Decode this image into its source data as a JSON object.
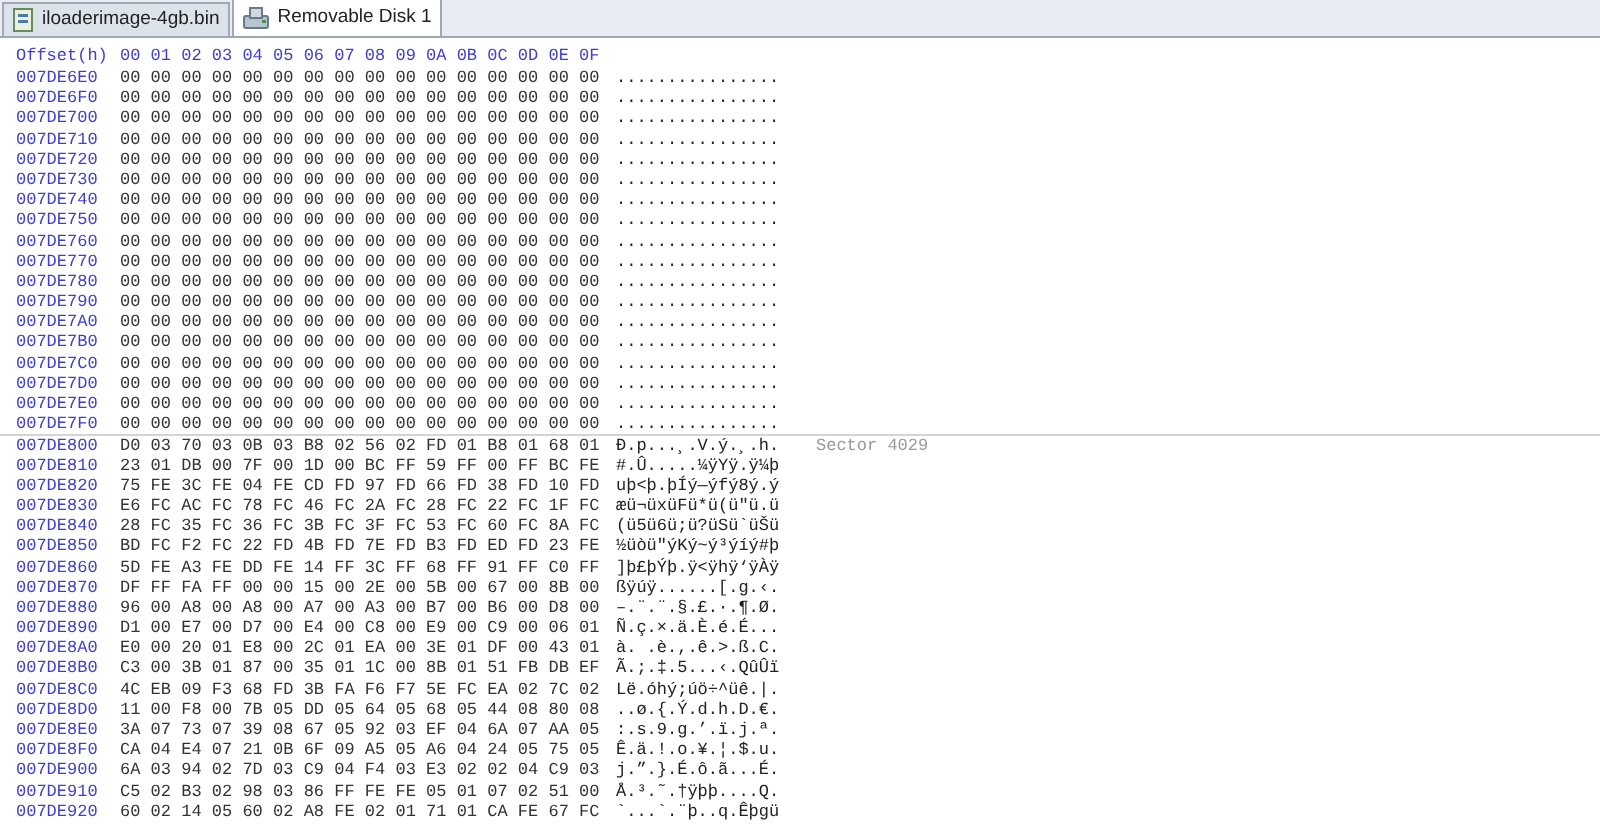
{
  "tabs": [
    {
      "label": "iloaderimage-4gb.bin",
      "selected": false,
      "kind": "file"
    },
    {
      "label": "Removable Disk 1",
      "selected": true,
      "kind": "disk"
    }
  ],
  "header": {
    "offset_label": "Offset(h)",
    "columns": "00 01 02 03 04 05 06 07 08 09 0A 0B 0C 0D 0E 0F"
  },
  "rows": [
    {
      "offset": "007DE6E0",
      "hex": "00 00 00 00 00 00 00 00 00 00 00 00 00 00 00 00",
      "ascii": "................"
    },
    {
      "offset": "007DE6F0",
      "hex": "00 00 00 00 00 00 00 00 00 00 00 00 00 00 00 00",
      "ascii": "................"
    },
    {
      "offset": "007DE700",
      "hex": "00 00 00 00 00 00 00 00 00 00 00 00 00 00 00 00",
      "ascii": "................"
    },
    {
      "offset": "007DE710",
      "hex": "00 00 00 00 00 00 00 00 00 00 00 00 00 00 00 00",
      "ascii": "................"
    },
    {
      "offset": "007DE720",
      "hex": "00 00 00 00 00 00 00 00 00 00 00 00 00 00 00 00",
      "ascii": "................"
    },
    {
      "offset": "007DE730",
      "hex": "00 00 00 00 00 00 00 00 00 00 00 00 00 00 00 00",
      "ascii": "................"
    },
    {
      "offset": "007DE740",
      "hex": "00 00 00 00 00 00 00 00 00 00 00 00 00 00 00 00",
      "ascii": "................"
    },
    {
      "offset": "007DE750",
      "hex": "00 00 00 00 00 00 00 00 00 00 00 00 00 00 00 00",
      "ascii": "................"
    },
    {
      "offset": "007DE760",
      "hex": "00 00 00 00 00 00 00 00 00 00 00 00 00 00 00 00",
      "ascii": "................"
    },
    {
      "offset": "007DE770",
      "hex": "00 00 00 00 00 00 00 00 00 00 00 00 00 00 00 00",
      "ascii": "................"
    },
    {
      "offset": "007DE780",
      "hex": "00 00 00 00 00 00 00 00 00 00 00 00 00 00 00 00",
      "ascii": "................"
    },
    {
      "offset": "007DE790",
      "hex": "00 00 00 00 00 00 00 00 00 00 00 00 00 00 00 00",
      "ascii": "................"
    },
    {
      "offset": "007DE7A0",
      "hex": "00 00 00 00 00 00 00 00 00 00 00 00 00 00 00 00",
      "ascii": "................"
    },
    {
      "offset": "007DE7B0",
      "hex": "00 00 00 00 00 00 00 00 00 00 00 00 00 00 00 00",
      "ascii": "................"
    },
    {
      "offset": "007DE7C0",
      "hex": "00 00 00 00 00 00 00 00 00 00 00 00 00 00 00 00",
      "ascii": "................"
    },
    {
      "offset": "007DE7D0",
      "hex": "00 00 00 00 00 00 00 00 00 00 00 00 00 00 00 00",
      "ascii": "................"
    },
    {
      "offset": "007DE7E0",
      "hex": "00 00 00 00 00 00 00 00 00 00 00 00 00 00 00 00",
      "ascii": "................"
    },
    {
      "offset": "007DE7F0",
      "hex": "00 00 00 00 00 00 00 00 00 00 00 00 00 00 00 00",
      "ascii": "................"
    },
    {
      "offset": "007DE800",
      "hex": "D0 03 70 03 0B 03 B8 02 56 02 FD 01 B8 01 68 01",
      "ascii": "Ð.p...¸.V.ý.¸.h.",
      "sector_label": "Sector 4029"
    },
    {
      "offset": "007DE810",
      "hex": "23 01 DB 00 7F 00 1D 00 BC FF 59 FF 00 FF BC FE",
      "ascii": "#.Û.....¼ÿYÿ.ÿ¼þ"
    },
    {
      "offset": "007DE820",
      "hex": "75 FE 3C FE 04 FE CD FD 97 FD 66 FD 38 FD 10 FD",
      "ascii": "uþ<þ.þÍý—ýfý8ý.ý"
    },
    {
      "offset": "007DE830",
      "hex": "E6 FC AC FC 78 FC 46 FC 2A FC 28 FC 22 FC 1F FC",
      "ascii": "æü¬üxüFü*ü(ü\"ü.ü"
    },
    {
      "offset": "007DE840",
      "hex": "28 FC 35 FC 36 FC 3B FC 3F FC 53 FC 60 FC 8A FC",
      "ascii": "(ü5ü6ü;ü?üSü`üŠü"
    },
    {
      "offset": "007DE850",
      "hex": "BD FC F2 FC 22 FD 4B FD 7E FD B3 FD ED FD 23 FE",
      "ascii": "½üòü\"ýKý~ý³ýíý#þ"
    },
    {
      "offset": "007DE860",
      "hex": "5D FE A3 FE DD FE 14 FF 3C FF 68 FF 91 FF C0 FF",
      "ascii": "]þ£þÝþ.ÿ<ÿhÿ‘ÿÀÿ"
    },
    {
      "offset": "007DE870",
      "hex": "DF FF FA FF 00 00 15 00 2E 00 5B 00 67 00 8B 00",
      "ascii": "ßÿúÿ......[.g.‹."
    },
    {
      "offset": "007DE880",
      "hex": "96 00 A8 00 A8 00 A7 00 A3 00 B7 00 B6 00 D8 00",
      "ascii": "–.¨.¨.§.£.·.¶.Ø."
    },
    {
      "offset": "007DE890",
      "hex": "D1 00 E7 00 D7 00 E4 00 C8 00 E9 00 C9 00 06 01",
      "ascii": "Ñ.ç.×.ä.È.é.É..."
    },
    {
      "offset": "007DE8A0",
      "hex": "E0 00 20 01 E8 00 2C 01 EA 00 3E 01 DF 00 43 01",
      "ascii": "à. .è.,.ê.>.ß.C."
    },
    {
      "offset": "007DE8B0",
      "hex": "C3 00 3B 01 87 00 35 01 1C 00 8B 01 51 FB DB EF",
      "ascii": "Ã.;.‡.5...‹.QûÛï"
    },
    {
      "offset": "007DE8C0",
      "hex": "4C EB 09 F3 68 FD 3B FA F6 F7 5E FC EA 02 7C 02",
      "ascii": "Lë.óhý;úö÷^üê.|."
    },
    {
      "offset": "007DE8D0",
      "hex": "11 00 F8 00 7B 05 DD 05 64 05 68 05 44 08 80 08",
      "ascii": "..ø.{.Ý.d.h.D.€."
    },
    {
      "offset": "007DE8E0",
      "hex": "3A 07 73 07 39 08 67 05 92 03 EF 04 6A 07 AA 05",
      "ascii": ":.s.9.g.’.ï.j.ª."
    },
    {
      "offset": "007DE8F0",
      "hex": "CA 04 E4 07 21 0B 6F 09 A5 05 A6 04 24 05 75 05",
      "ascii": "Ê.ä.!.o.¥.¦.$.u."
    },
    {
      "offset": "007DE900",
      "hex": "6A 03 94 02 7D 03 C9 04 F4 03 E3 02 02 04 C9 03",
      "ascii": "j.”.}.É.ô.ã...É."
    },
    {
      "offset": "007DE910",
      "hex": "C5 02 B3 02 98 03 86 FF FE FE 05 01 07 02 51 00",
      "ascii": "Å.³.˜.†ÿþþ....Q."
    },
    {
      "offset": "007DE920",
      "hex": "60 02 14 05 60 02 A8 FE 02 01 71 01 CA FE 67 FC",
      "ascii": "`...`.¨þ..q.Êþgü"
    }
  ]
}
